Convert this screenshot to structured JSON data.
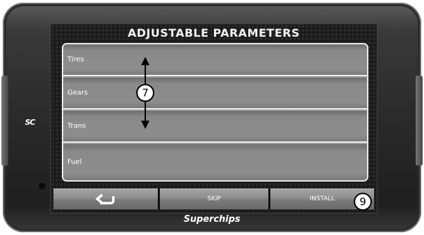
{
  "screen": {
    "title": "ADJUSTABLE PARAMETERS",
    "items": [
      {
        "label": "Tires"
      },
      {
        "label": "Gears"
      },
      {
        "label": "Trans"
      },
      {
        "label": "Fuel"
      }
    ]
  },
  "buttons": {
    "back_icon": "back-arrow-icon",
    "skip_label": "SKIP",
    "install_label": "INSTALL"
  },
  "device": {
    "logo_left": "SC",
    "logo_bottom": "Superchips"
  },
  "callouts": {
    "scroll": "7",
    "install": "9"
  },
  "colors": {
    "accent": "#ffffff",
    "bezel": "#2a2a2a",
    "row": "#8a8a8a"
  }
}
